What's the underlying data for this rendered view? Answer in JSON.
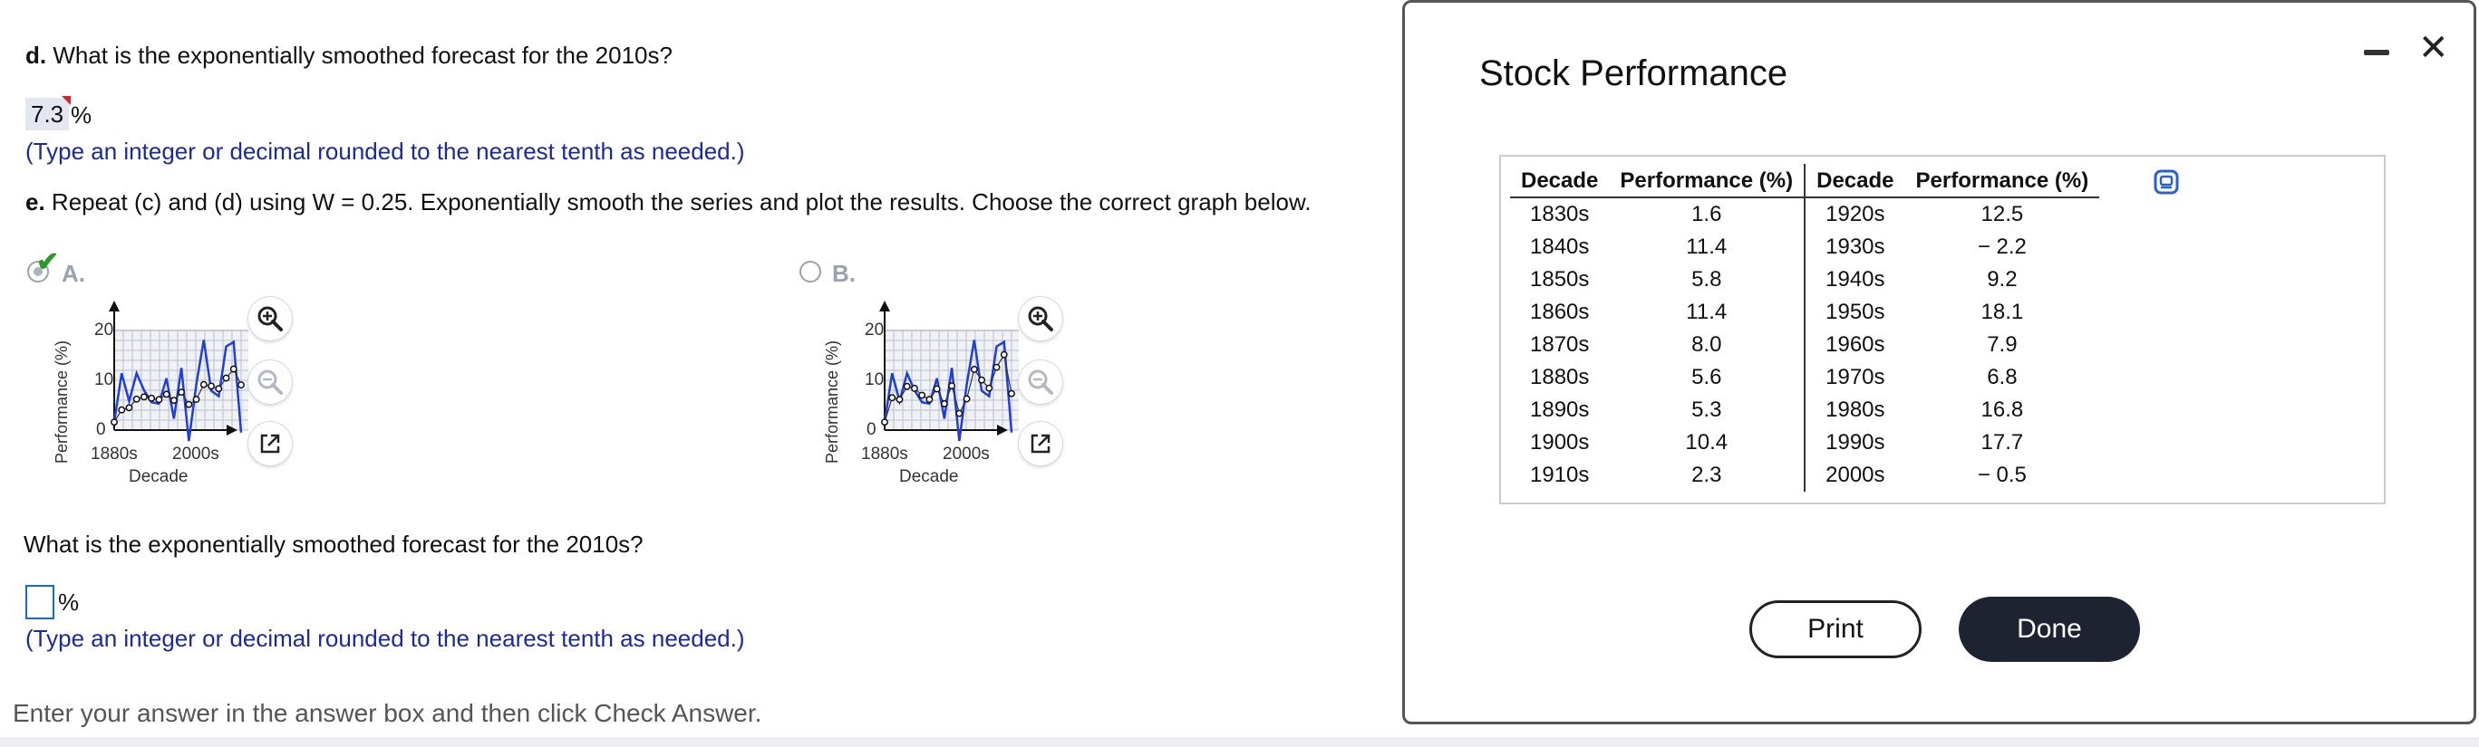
{
  "question_d": {
    "label": "d.",
    "text": "What is the exponentially smoothed forecast for the 2010s?",
    "answer": "7.3",
    "unit": "%",
    "hint": "(Type an integer or decimal rounded to the nearest tenth as needed.)"
  },
  "question_e": {
    "label": "e.",
    "text": "Repeat (c) and (d) using W = 0.25. Exponentially smooth the series and plot the results. Choose the correct graph below."
  },
  "options": [
    {
      "letter": "A.",
      "selected": true,
      "ylabel": "Performance (%)",
      "xlabel": "Decade",
      "yticks": [
        "20",
        "10",
        "0"
      ],
      "xticks": [
        "1880s",
        "2000s"
      ]
    },
    {
      "letter": "B.",
      "selected": false,
      "ylabel": "Performance (%)",
      "xlabel": "Decade",
      "yticks": [
        "20",
        "10",
        "0"
      ],
      "xticks": [
        "1880s",
        "2000s"
      ]
    }
  ],
  "question_f": {
    "text": "What is the exponentially smoothed forecast for the 2010s?",
    "answer": "",
    "unit": "%",
    "hint": "(Type an integer or decimal rounded to the nearest tenth as needed.)"
  },
  "footer": {
    "instruction": "Enter your answer in the answer box and then click Check Answer."
  },
  "popup": {
    "title": "Stock Performance",
    "headers": [
      "Decade",
      "Performance (%)",
      "Decade",
      "Performance (%)"
    ],
    "rows": [
      [
        "1830s",
        "1.6",
        "1920s",
        "12.5"
      ],
      [
        "1840s",
        "11.4",
        "1930s",
        "− 2.2"
      ],
      [
        "1850s",
        "5.8",
        "1940s",
        "9.2"
      ],
      [
        "1860s",
        "11.4",
        "1950s",
        "18.1"
      ],
      [
        "1870s",
        "8.0",
        "1960s",
        "7.9"
      ],
      [
        "1880s",
        "5.6",
        "1970s",
        "6.8"
      ],
      [
        "1890s",
        "5.3",
        "1980s",
        "16.8"
      ],
      [
        "1900s",
        "10.4",
        "1990s",
        "17.7"
      ],
      [
        "1910s",
        "2.3",
        "2000s",
        "− 0.5"
      ]
    ],
    "print_label": "Print",
    "done_label": "Done"
  },
  "icons": {
    "zoom_in": "zoom-in-icon",
    "zoom_out": "zoom-out-icon",
    "pop_out": "external-link-icon",
    "copy": "copy-icon",
    "minimize": "minimize-icon",
    "close": "close-icon",
    "check": "checkmark-icon"
  },
  "colors": {
    "hint_blue": "#1a2a9e",
    "series_blue": "#1f3fd6",
    "done_button": "#1d2331",
    "correct_green": "#2a9b2a"
  }
}
